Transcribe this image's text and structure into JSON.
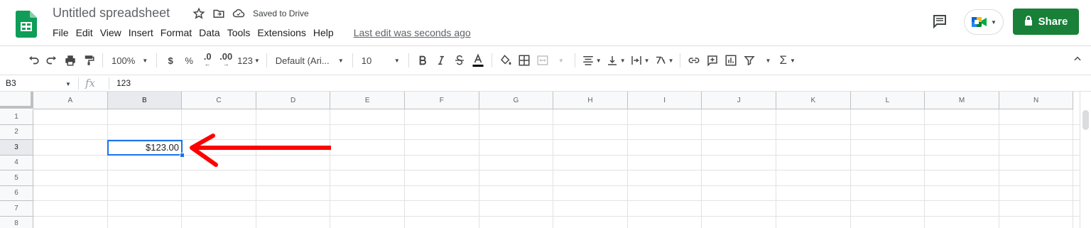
{
  "app": {
    "title": "Untitled spreadsheet",
    "saved_status": "Saved to Drive",
    "last_edit": "Last edit was seconds ago",
    "share_label": "Share",
    "brand_green": "#0f9d58",
    "share_color": "#188038"
  },
  "menu": [
    "File",
    "Edit",
    "View",
    "Insert",
    "Format",
    "Data",
    "Tools",
    "Extensions",
    "Help"
  ],
  "toolbar": {
    "zoom": "100%",
    "currency": "$",
    "percent": "%",
    "decrease_decimal": ".0",
    "increase_decimal": ".00",
    "more_formats": "123",
    "font": "Default (Ari...",
    "font_size": "10"
  },
  "formula_bar": {
    "name_box": "B3",
    "fx": "fx",
    "value": "123"
  },
  "grid": {
    "columns": [
      "A",
      "B",
      "C",
      "D",
      "E",
      "F",
      "G",
      "H",
      "I",
      "J",
      "K",
      "L",
      "M",
      "N"
    ],
    "rows": [
      "1",
      "2",
      "3",
      "4",
      "5",
      "6",
      "7",
      "8"
    ],
    "active_cell_value": "$123.00",
    "selection_color": "#1a73e8"
  },
  "annotation": {
    "arrow_color": "#ff0000"
  }
}
